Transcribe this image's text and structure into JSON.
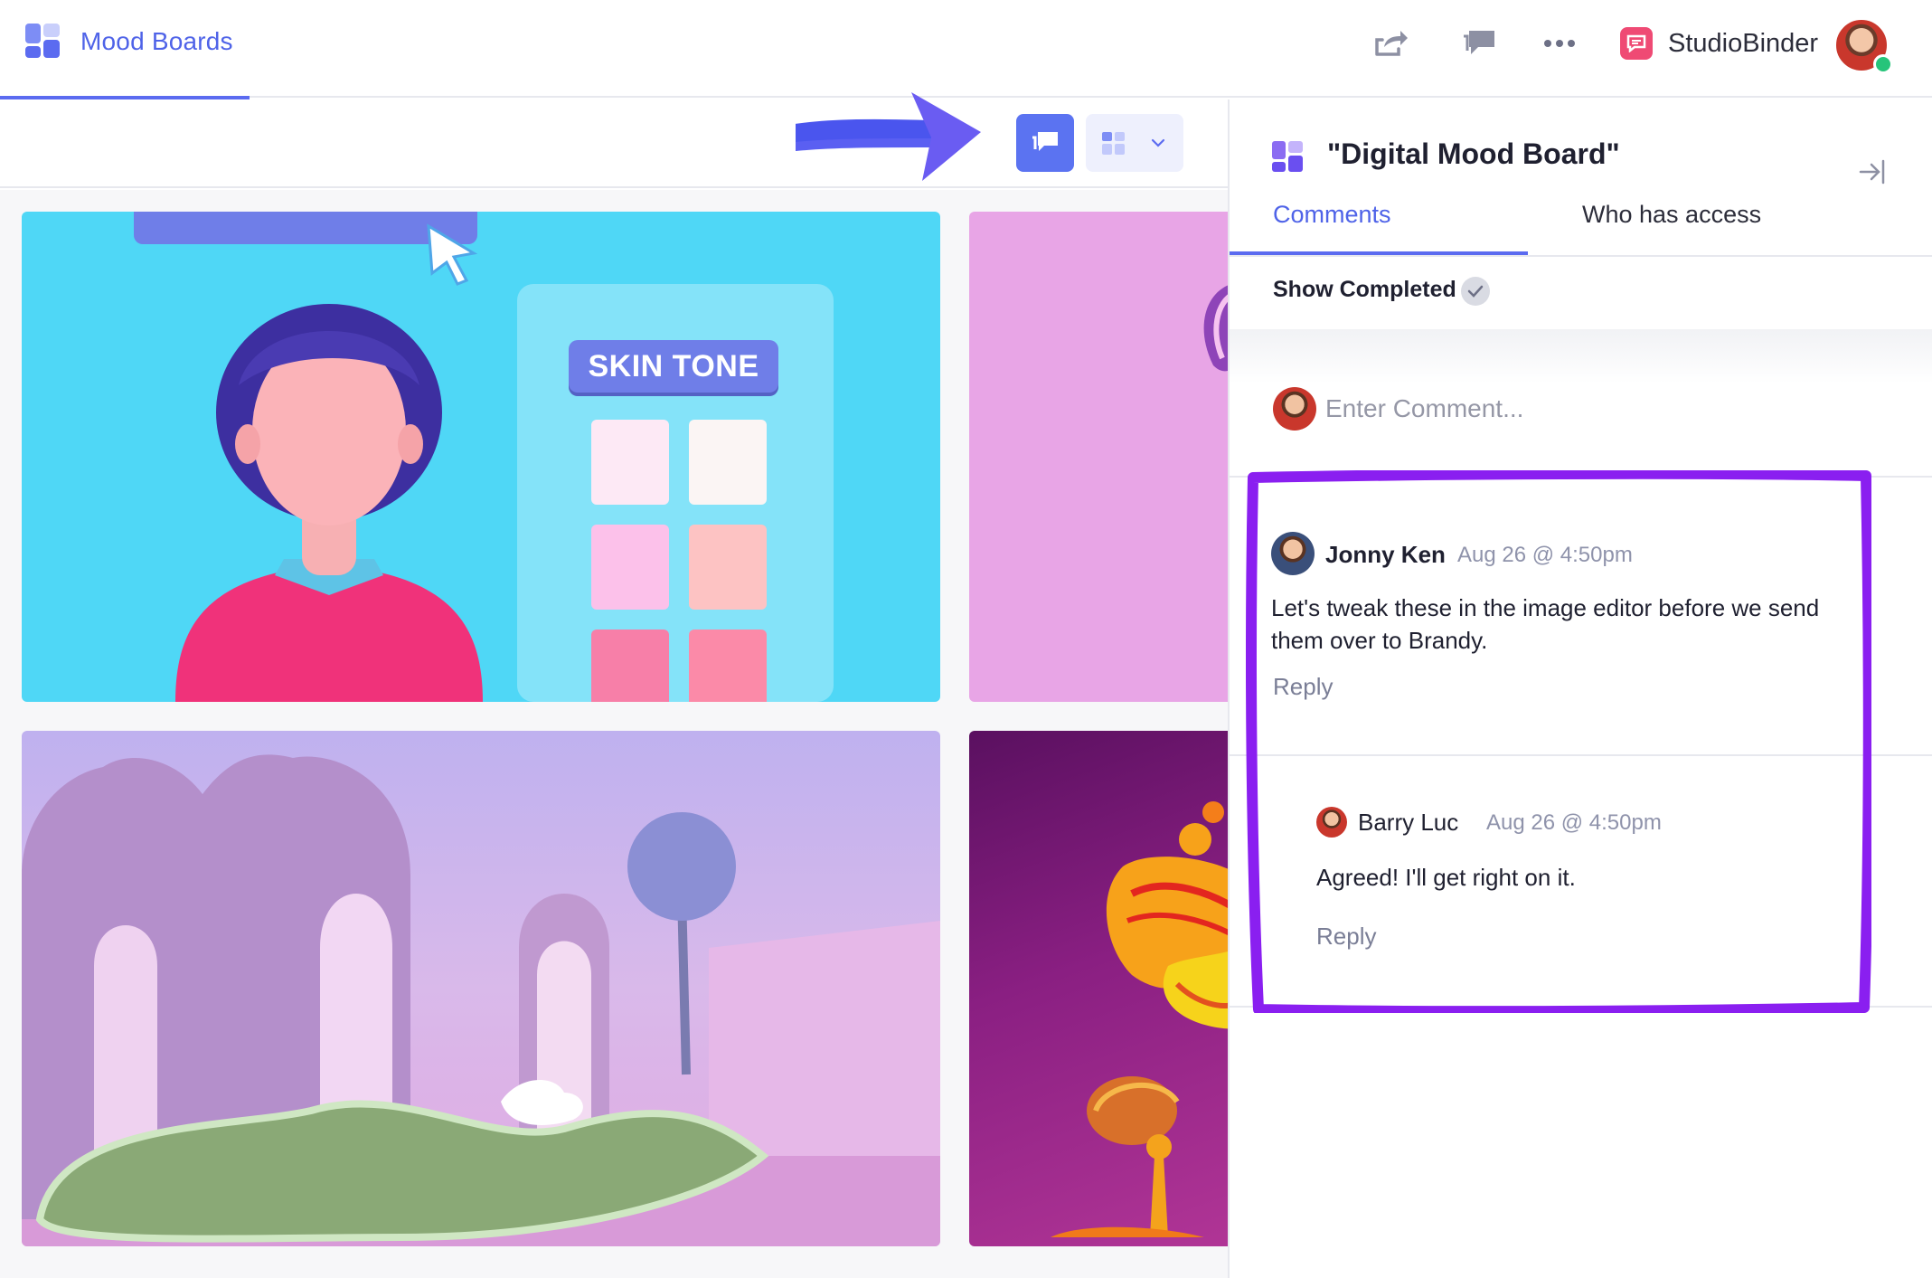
{
  "app": {
    "title": "Mood Boards",
    "brand_name": "StudioBinder",
    "accent_color": "#5b6bf0",
    "icons": [
      "share-icon",
      "comments-icon",
      "more-icon",
      "studiobinder-logo-icon"
    ]
  },
  "board": {
    "tile_label": "SKIN TONE",
    "swatches": [
      "#fde9f5",
      "#fbf5f4",
      "#fcc1ea",
      "#fdc3c3",
      "#f77fa8",
      "#fb8aa8"
    ]
  },
  "panel": {
    "title": "\"Digital Mood Board\"",
    "tabs": [
      {
        "label": "Comments",
        "active": true
      },
      {
        "label": "Who has access",
        "active": false
      }
    ],
    "show_completed_label": "Show Completed",
    "comment_placeholder": "Enter Comment...",
    "comments": [
      {
        "author": "Jonny Ken",
        "time": "Aug 26 @ 4:50pm",
        "text": "Let's tweak these in the image editor before we send them over to Brandy.",
        "reply_label": "Reply"
      },
      {
        "author": "Barry Luc",
        "time": "Aug 26 @ 4:50pm",
        "text": "Agreed! I'll get right on it.",
        "reply_label": "Reply"
      }
    ]
  }
}
